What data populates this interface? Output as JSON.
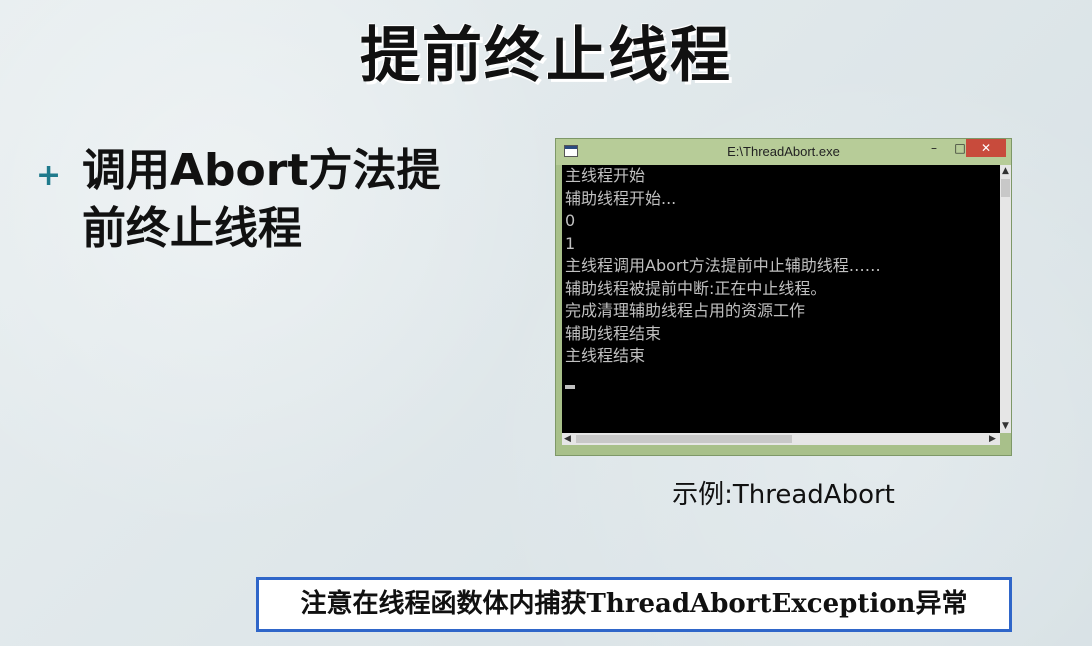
{
  "slide": {
    "title": "提前终止线程",
    "bullet_marker": "+",
    "bullet_text": "调用Abort方法提\n前终止线程"
  },
  "console_window": {
    "title": "E:\\ThreadAbort.exe",
    "buttons": {
      "minimize": "–",
      "maximize": "□",
      "close": "✕"
    },
    "lines": [
      "主线程开始",
      "辅助线程开始...",
      "0",
      "1",
      "主线程调用Abort方法提前中止辅助线程……",
      "辅助线程被提前中断:正在中止线程。",
      "完成清理辅助线程占用的资源工作",
      "辅助线程结束",
      "主线程结束"
    ],
    "scroll_icons": {
      "up": "▲",
      "down": "▼",
      "left": "◀",
      "right": "▶"
    }
  },
  "caption": "示例:ThreadAbort",
  "note": "注意在线程函数体内捕获ThreadAbortException异常",
  "colors": {
    "bullet_marker": "#1f7a8c",
    "note_border": "#2f66c9",
    "window_frame": "#a8c08a",
    "close_button": "#c84b3c"
  }
}
